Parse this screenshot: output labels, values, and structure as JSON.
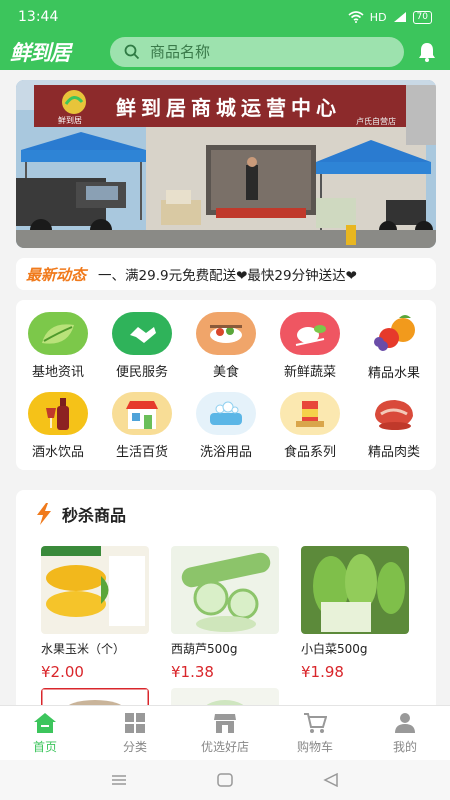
{
  "status": {
    "time": "13:44",
    "network": "HD",
    "battery": "70"
  },
  "header": {
    "logo": "鲜到居",
    "search_placeholder": "商品名称"
  },
  "banner": {
    "sign_text": "鲜到居商城运营中心",
    "sign_sub": "卢氏自营店",
    "logo_text": "鲜到居"
  },
  "news": {
    "label": "最新动态",
    "text": "一、满29.9元免费配送❤最快29分钟送达❤"
  },
  "categories": [
    {
      "label": "基地资讯",
      "icon": "leaf-icon"
    },
    {
      "label": "便民服务",
      "icon": "handshake-icon"
    },
    {
      "label": "美食",
      "icon": "food-bowl-icon"
    },
    {
      "label": "新鲜蔬菜",
      "icon": "vegetable-icon"
    },
    {
      "label": "精品水果",
      "icon": "fruit-icon"
    },
    {
      "label": "酒水饮品",
      "icon": "wine-icon"
    },
    {
      "label": "生活百货",
      "icon": "store-icon"
    },
    {
      "label": "洗浴用品",
      "icon": "bath-icon"
    },
    {
      "label": "食品系列",
      "icon": "snack-icon"
    },
    {
      "label": "精品肉类",
      "icon": "meat-icon"
    }
  ],
  "flash_sale": {
    "title": "秒杀商品",
    "products": [
      {
        "name": "水果玉米（个）",
        "price": "¥2.00"
      },
      {
        "name": "西葫芦500g",
        "price": "¥1.38"
      },
      {
        "name": "小白菜500g",
        "price": "¥1.98"
      }
    ]
  },
  "tabs": [
    {
      "label": "首页",
      "icon": "home-icon",
      "active": true
    },
    {
      "label": "分类",
      "icon": "grid-icon",
      "active": false
    },
    {
      "label": "优选好店",
      "icon": "shop-icon",
      "active": false
    },
    {
      "label": "购物车",
      "icon": "cart-icon",
      "active": false
    },
    {
      "label": "我的",
      "icon": "user-icon",
      "active": false
    }
  ],
  "colors": {
    "brand": "#3cc55c",
    "price": "#d9262b",
    "news_label": "#f07a1c"
  }
}
